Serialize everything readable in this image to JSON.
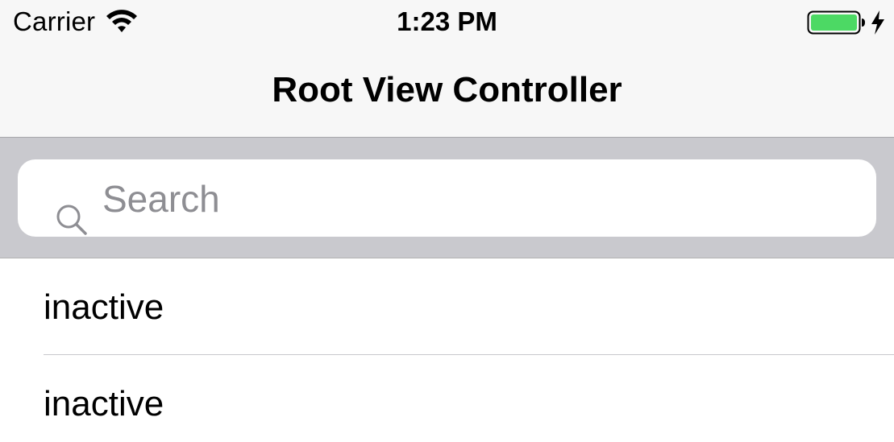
{
  "status_bar": {
    "carrier": "Carrier",
    "time": "1:23 PM",
    "wifi_icon": "wifi-icon",
    "battery_icon": "battery-icon",
    "charging_icon": "charging-bolt-icon",
    "battery_color": "#4cd964"
  },
  "nav_bar": {
    "title": "Root View Controller"
  },
  "search": {
    "placeholder": "Search",
    "icon": "search-icon"
  },
  "table": {
    "rows": [
      {
        "label": "inactive"
      },
      {
        "label": "inactive"
      }
    ]
  },
  "colors": {
    "nav_background": "#f7f7f7",
    "search_bar_background": "#c9c9ce",
    "placeholder": "#8e8e93"
  }
}
